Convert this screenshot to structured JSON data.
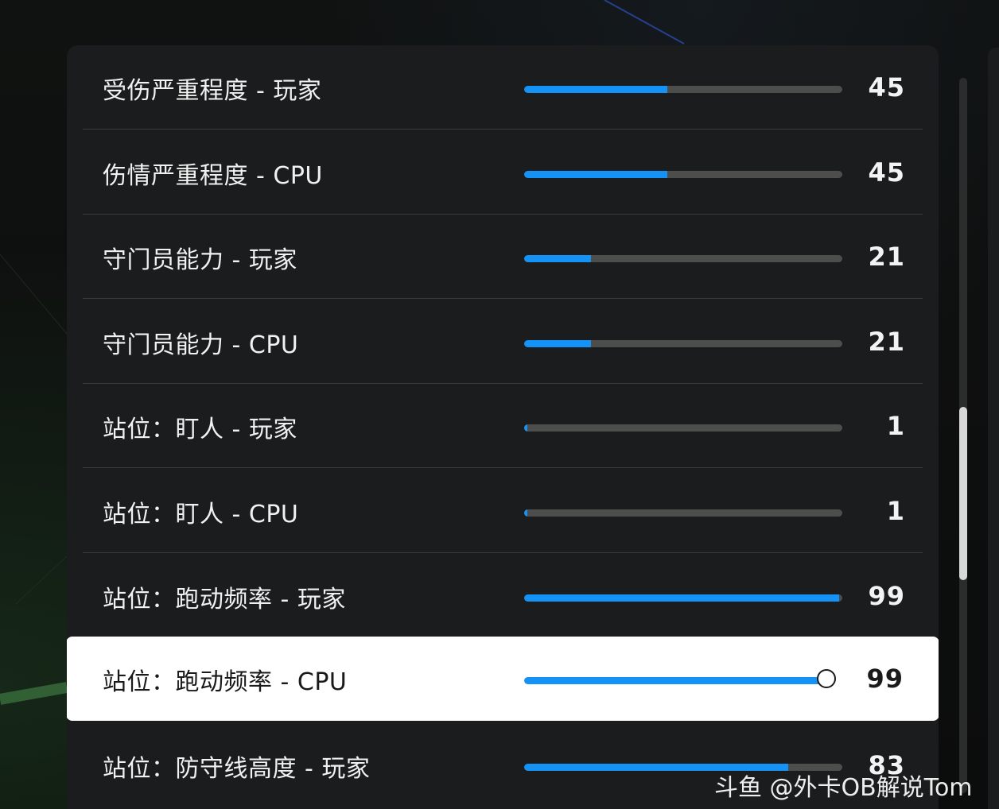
{
  "settings": {
    "rows": [
      {
        "label": "受伤严重程度 - 玩家",
        "value": "45",
        "level": 45,
        "selected": false
      },
      {
        "label": "伤情严重程度 - CPU",
        "value": "45",
        "level": 45,
        "selected": false
      },
      {
        "label": "守门员能力 - 玩家",
        "value": "21",
        "level": 21,
        "selected": false
      },
      {
        "label": "守门员能力 - CPU",
        "value": "21",
        "level": 21,
        "selected": false
      },
      {
        "label": "站位：盯人 - 玩家",
        "value": "1",
        "level": 1,
        "selected": false
      },
      {
        "label": "站位：盯人 - CPU",
        "value": "1",
        "level": 1,
        "selected": false
      },
      {
        "label": "站位：跑动频率 - 玩家",
        "value": "99",
        "level": 99,
        "selected": false
      },
      {
        "label": "站位：跑动频率 - CPU",
        "value": "99",
        "level": 99,
        "selected": true
      },
      {
        "label": "站位：防守线高度 - 玩家",
        "value": "83",
        "level": 83,
        "selected": false
      }
    ]
  },
  "colors": {
    "fill": "#1592f5",
    "track": "#4d4e4c",
    "panel": "#1b1c1d",
    "selected_bg": "#ffffff"
  },
  "watermark": "斗鱼 @外卡OB解说Tom"
}
